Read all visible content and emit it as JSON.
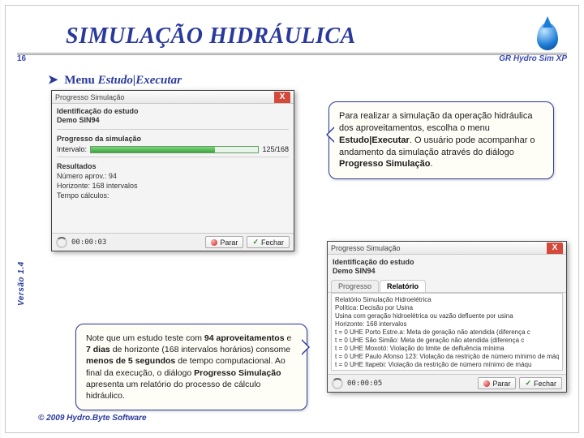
{
  "header": {
    "title": "SIMULAÇÃO HIDRÁULICA",
    "page_number": "16",
    "app_name": "GR Hydro Sim XP"
  },
  "menu_line": {
    "chevron": "➤",
    "word_menu": "Menu",
    "path": "Estudo|Executar"
  },
  "dialog1": {
    "title": "Progresso Simulação",
    "sec1_title": "Identificação do estudo",
    "sec1_value": "Demo SIN94",
    "sec2_title": "Progresso da simulação",
    "interval_label": "Intervalo:",
    "interval_value": "125/168",
    "sec3_title": "Resultados",
    "r1": "Número aprov.: 94",
    "r2": "Horizonte: 168 intervalos",
    "r3": "Tempo cálculos:",
    "elapsed": "00:00:03",
    "btn_stop": "Parar",
    "btn_close": "Fechar",
    "close_x": "X"
  },
  "dialog2": {
    "title": "Progresso Simulação",
    "sec1_title": "Identificação do estudo",
    "sec1_value": "Demo SIN94",
    "tab1": "Progresso",
    "tab2": "Relatório",
    "report_lines": [
      "Relatório Simulação Hidroelétrica",
      "Política: Decisão por Usina",
      "Usina com geração hidroelétrica ou vazão defluente por usina",
      "Horizonte: 168 intervalos",
      "t = 0 UHE Porto Estre.a: Meta de geração não atendida (diferença c",
      "t = 0 UHE São Simão: Meta de geração não atendida (diferença c",
      "t = 0 UHE Moxotó: Violação do limite de defluência mínima",
      "t = 0 UHE Paulo Afonso 123: Violação da restrição de número mínimo de máqu",
      "t = 0 UHE Itapebi: Violação da restrição de número mínimo de máqu"
    ],
    "elapsed": "00:00:05",
    "btn_stop": "Parar",
    "btn_close": "Fechar",
    "close_x": "X"
  },
  "bubble1": {
    "t1": "Para realizar a simulação da operação hidráulica dos aproveitamentos, escolha o menu ",
    "b1": "Estudo|Executar",
    "t2": ". O usuário pode acompanhar o andamento da simulação através do diálogo ",
    "b2": "Progresso Simulação",
    "t3": "."
  },
  "bubble2": {
    "t1": "Note que um estudo teste com ",
    "b1": "94 aproveitamentos",
    "t2": " e ",
    "b2": "7 dias",
    "t3": " de horizonte (168 intervalos horários) consome ",
    "b3": "menos de 5 segundos",
    "t4": " de tempo computacional. Ao final da execução, o diálogo ",
    "b4": "Progresso Simulação",
    "t5": " apresenta um relatório do processo de cálculo hidráulico."
  },
  "footer": {
    "version": "Versão 1.4",
    "copyright": "© 2009 Hydro.Byte Software"
  }
}
